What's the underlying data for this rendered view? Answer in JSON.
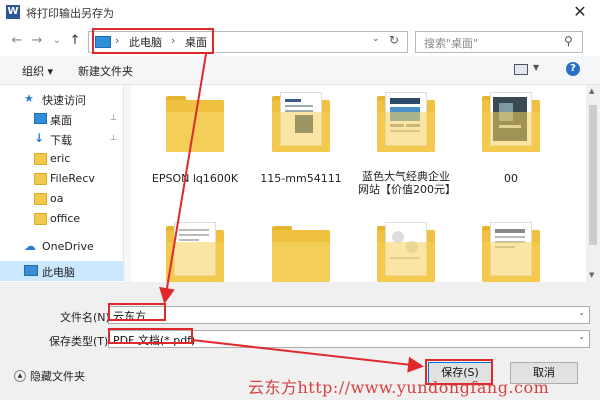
{
  "window": {
    "title": "将打印输出另存为",
    "app_icon": "W",
    "close_glyph": "✕"
  },
  "nav": {
    "back_glyph": "←",
    "forward_glyph": "→",
    "recent_glyph": "⌄",
    "up_glyph": "↑",
    "breadcrumb": [
      "此电脑",
      "桌面"
    ],
    "separator": "›",
    "search_placeholder": "搜索\"桌面\"",
    "refresh_glyph": "↻",
    "dropdown_glyph": "⌄",
    "search_icon_glyph": "⚲"
  },
  "toolbar": {
    "organize": "组织 ▾",
    "new_folder": "新建文件夹",
    "view_drop": "▼",
    "help": "?"
  },
  "sidebar": {
    "items": [
      {
        "label": "快速访问",
        "icon": "star-icon"
      },
      {
        "label": "桌面",
        "icon": "desktop-icon",
        "pinned": true
      },
      {
        "label": "下载",
        "icon": "download-icon",
        "pinned": true
      },
      {
        "label": "eric",
        "icon": "folder-icon"
      },
      {
        "label": "FileRecv",
        "icon": "folder-icon"
      },
      {
        "label": "oa",
        "icon": "folder-icon"
      },
      {
        "label": "office",
        "icon": "folder-icon"
      },
      {
        "label": "OneDrive",
        "icon": "onedrive-icon"
      },
      {
        "label": "此电脑",
        "icon": "pc-icon",
        "selected": true
      }
    ],
    "pin_glyph": "📌"
  },
  "files": [
    {
      "label": "EPSON lq1600K"
    },
    {
      "label": "115-mm54111"
    },
    {
      "label": "蓝色大气经典企业网站【价值200元】"
    },
    {
      "label": "00"
    },
    {
      "label": ""
    },
    {
      "label": ""
    },
    {
      "label": ""
    },
    {
      "label": ""
    }
  ],
  "form": {
    "filename_label": "文件名(N):",
    "filename_value": "云东方",
    "savetype_label": "保存类型(T):",
    "savetype_value": "PDF 文档(*.pdf)",
    "drop_glyph": "⌄"
  },
  "footer": {
    "hide_folders": "隐藏文件夹",
    "hide_glyph": "▲",
    "save_button": "保存(S)",
    "cancel_button": "取消"
  },
  "watermark": "云东方http://www.yundongfang.com",
  "colors": {
    "highlight": "#e0292d",
    "accent": "#0078d7"
  }
}
